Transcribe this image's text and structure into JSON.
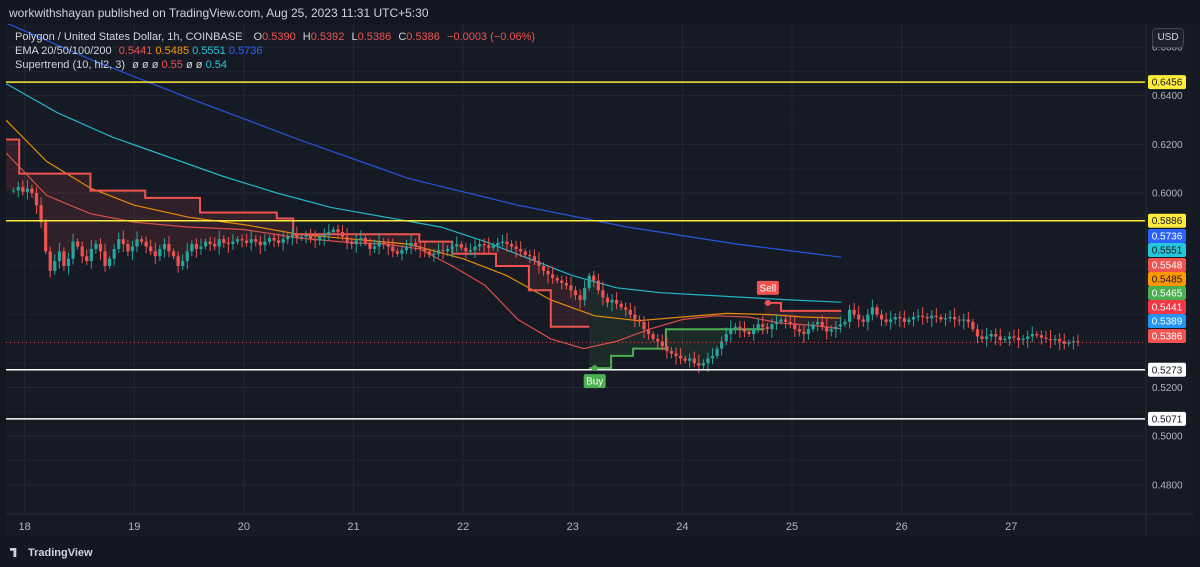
{
  "header": {
    "publisher": "workwithshayan published on TradingView.com, Aug 25, 2023 11:31 UTC+5:30"
  },
  "legend": {
    "symbol": "Polygon / United States Dollar, 1h, COINBASE",
    "ohlc": [
      {
        "k": "O",
        "v": "0.5390"
      },
      {
        "k": "H",
        "v": "0.5392"
      },
      {
        "k": "L",
        "v": "0.5386"
      },
      {
        "k": "C",
        "v": "0.5386"
      }
    ],
    "change": "−0.0003 (−0.06%)",
    "ema_label": "EMA 20/50/100/200",
    "ema_values": [
      {
        "v": "0.5441",
        "color": "#ef5350"
      },
      {
        "v": "0.5485",
        "color": "#ff9800"
      },
      {
        "v": "0.5551",
        "color": "#26c6da"
      },
      {
        "v": "0.5736",
        "color": "#2962ff"
      }
    ],
    "supertrend_label": "Supertrend (10, hl2, 3)",
    "supertrend_symbols": "ø ø ø",
    "supertrend_values": [
      {
        "v": "0.55",
        "color": "#ef5350"
      },
      {
        "v": "ø",
        "color": "#d1d4dc"
      },
      {
        "v": "ø",
        "color": "#d1d4dc"
      },
      {
        "v": "0.54",
        "color": "#26c6da"
      }
    ]
  },
  "currency": "USD",
  "footer": {
    "brand": "TradingView"
  },
  "chart_data": {
    "type": "candlestick",
    "y_axis_ticks": [
      "0.6600",
      "0.6400",
      "0.6200",
      "0.6000",
      "0.5200",
      "0.5000",
      "0.4800"
    ],
    "ylim": [
      0.468,
      0.6695
    ],
    "x_axis_ticks": [
      {
        "label": "18",
        "day": 18
      },
      {
        "label": "19",
        "day": 19
      },
      {
        "label": "20",
        "day": 20
      },
      {
        "label": "21",
        "day": 21
      },
      {
        "label": "22",
        "day": 22
      },
      {
        "label": "23",
        "day": 23
      },
      {
        "label": "24",
        "day": 24
      },
      {
        "label": "25",
        "day": 25
      },
      {
        "label": "26",
        "day": 26
      },
      {
        "label": "27",
        "day": 27
      }
    ],
    "xlim": [
      17.83,
      28.22
    ],
    "horizontal_levels": [
      {
        "value": 0.6456,
        "label": "0.6456",
        "color": "#ffeb3b"
      },
      {
        "value": 0.5886,
        "label": "0.5886",
        "color": "#ffeb3b"
      },
      {
        "value": 0.5273,
        "label": "0.5273",
        "color": "#ffffff"
      },
      {
        "value": 0.5071,
        "label": "0.5071",
        "color": "#ffffff"
      }
    ],
    "price_badges": [
      {
        "value": 0.5736,
        "label": "0.5736",
        "bg": "#2962ff",
        "fg": "#ffffff"
      },
      {
        "value": 0.5551,
        "label": "0.5551",
        "bg": "#26c6da",
        "fg": "#131722"
      },
      {
        "value": 0.5548,
        "label": "0.5548",
        "bg": "#ef5350",
        "fg": "#ffffff"
      },
      {
        "value": 0.5485,
        "label": "0.5485",
        "bg": "#ff9800",
        "fg": "#131722"
      },
      {
        "value": 0.5465,
        "label": "0.5465",
        "bg": "#4caf50",
        "fg": "#ffffff"
      },
      {
        "value": 0.5441,
        "label": "0.5441",
        "bg": "#f23645",
        "fg": "#ffffff"
      },
      {
        "value": 0.5389,
        "label": "0.5389",
        "bg": "#2196f3",
        "fg": "#ffffff"
      },
      {
        "value": 0.5386,
        "label": "0.5386",
        "bg": "#ef5350",
        "fg": "#ffffff"
      }
    ],
    "last_price": 0.5386,
    "ema_lines": [
      {
        "name": "EMA 20",
        "color": "#ef5350",
        "points": [
          [
            17.83,
            0.6165
          ],
          [
            18.2,
            0.599
          ],
          [
            18.6,
            0.5915
          ],
          [
            19.0,
            0.588
          ],
          [
            19.5,
            0.586
          ],
          [
            20.0,
            0.585
          ],
          [
            20.5,
            0.5815
          ],
          [
            21.0,
            0.5795
          ],
          [
            21.3,
            0.579
          ],
          [
            21.6,
            0.577
          ],
          [
            21.9,
            0.57
          ],
          [
            22.2,
            0.562
          ],
          [
            22.5,
            0.548
          ],
          [
            22.8,
            0.54
          ],
          [
            23.1,
            0.536
          ],
          [
            23.4,
            0.539
          ],
          [
            23.7,
            0.544
          ],
          [
            24.0,
            0.548
          ],
          [
            24.3,
            0.5495
          ],
          [
            24.6,
            0.549
          ],
          [
            24.9,
            0.5465
          ],
          [
            25.2,
            0.5455
          ],
          [
            25.45,
            0.5441
          ]
        ]
      },
      {
        "name": "EMA 50",
        "color": "#ff9800",
        "points": [
          [
            17.83,
            0.63
          ],
          [
            18.2,
            0.613
          ],
          [
            18.6,
            0.602
          ],
          [
            19.0,
            0.595
          ],
          [
            19.5,
            0.59
          ],
          [
            20.0,
            0.587
          ],
          [
            20.5,
            0.583
          ],
          [
            21.0,
            0.581
          ],
          [
            21.5,
            0.579
          ],
          [
            22.0,
            0.573
          ],
          [
            22.4,
            0.566
          ],
          [
            22.8,
            0.556
          ],
          [
            23.2,
            0.5495
          ],
          [
            23.6,
            0.5475
          ],
          [
            24.0,
            0.549
          ],
          [
            24.4,
            0.5505
          ],
          [
            24.8,
            0.55
          ],
          [
            25.1,
            0.549
          ],
          [
            25.45,
            0.5485
          ]
        ]
      },
      {
        "name": "EMA 100",
        "color": "#26c6da",
        "points": [
          [
            17.83,
            0.645
          ],
          [
            18.3,
            0.633
          ],
          [
            18.8,
            0.623
          ],
          [
            19.3,
            0.615
          ],
          [
            19.8,
            0.607
          ],
          [
            20.3,
            0.6
          ],
          [
            20.8,
            0.594
          ],
          [
            21.3,
            0.59
          ],
          [
            21.8,
            0.586
          ],
          [
            22.2,
            0.58
          ],
          [
            22.6,
            0.573
          ],
          [
            23.0,
            0.566
          ],
          [
            23.4,
            0.561
          ],
          [
            23.8,
            0.559
          ],
          [
            24.2,
            0.558
          ],
          [
            24.6,
            0.557
          ],
          [
            25.0,
            0.556
          ],
          [
            25.45,
            0.5551
          ]
        ]
      },
      {
        "name": "EMA 200",
        "color": "#2962ff",
        "points": [
          [
            17.83,
            0.67
          ],
          [
            18.6,
            0.655
          ],
          [
            19.5,
            0.639
          ],
          [
            20.5,
            0.622
          ],
          [
            21.5,
            0.606
          ],
          [
            22.5,
            0.595
          ],
          [
            23.5,
            0.586
          ],
          [
            24.5,
            0.579
          ],
          [
            25.45,
            0.5736
          ]
        ]
      }
    ],
    "supertrend": {
      "down_color": "#ef5350",
      "up_color": "#4caf50",
      "down_points": [
        [
          17.83,
          0.622
        ],
        [
          17.95,
          0.622
        ],
        [
          17.95,
          0.608
        ],
        [
          18.6,
          0.608
        ],
        [
          18.6,
          0.601
        ],
        [
          19.1,
          0.601
        ],
        [
          19.1,
          0.598
        ],
        [
          19.6,
          0.598
        ],
        [
          19.6,
          0.592
        ],
        [
          20.3,
          0.592
        ],
        [
          20.3,
          0.5895
        ],
        [
          20.45,
          0.5895
        ],
        [
          20.45,
          0.583
        ],
        [
          21.6,
          0.583
        ],
        [
          21.6,
          0.58
        ],
        [
          21.9,
          0.58
        ],
        [
          21.9,
          0.575
        ],
        [
          22.3,
          0.575
        ],
        [
          22.3,
          0.57
        ],
        [
          22.6,
          0.57
        ],
        [
          22.6,
          0.56
        ],
        [
          22.8,
          0.56
        ],
        [
          22.8,
          0.545
        ],
        [
          23.15,
          0.545
        ]
      ],
      "up_points": [
        [
          23.15,
          0.528
        ],
        [
          23.35,
          0.528
        ],
        [
          23.35,
          0.533
        ],
        [
          23.55,
          0.533
        ],
        [
          23.55,
          0.536
        ],
        [
          23.85,
          0.536
        ],
        [
          23.85,
          0.544
        ],
        [
          24.75,
          0.544
        ]
      ],
      "down2_points": [
        [
          24.75,
          0.5548
        ],
        [
          24.9,
          0.5548
        ],
        [
          24.9,
          0.5515
        ],
        [
          25.45,
          0.5515
        ]
      ],
      "signals": [
        {
          "label": "Buy",
          "day": 23.2,
          "price": 0.528,
          "color": "#4caf50"
        },
        {
          "label": "Sell",
          "day": 24.78,
          "price": 0.5548,
          "color": "#ef5350"
        }
      ]
    },
    "candles_hourly": [
      0.601,
      0.6025,
      0.6005,
      0.6018,
      0.6,
      0.595,
      0.588,
      0.576,
      0.568,
      0.572,
      0.576,
      0.57,
      0.573,
      0.58,
      0.578,
      0.574,
      0.572,
      0.577,
      0.579,
      0.576,
      0.57,
      0.573,
      0.577,
      0.581,
      0.579,
      0.576,
      0.578,
      0.581,
      0.58,
      0.578,
      0.576,
      0.574,
      0.577,
      0.579,
      0.576,
      0.574,
      0.57,
      0.572,
      0.576,
      0.579,
      0.577,
      0.578,
      0.58,
      0.579,
      0.578,
      0.581,
      0.5795,
      0.579,
      0.58,
      0.581,
      0.5805,
      0.5795,
      0.581,
      0.58,
      0.5785,
      0.58,
      0.5815,
      0.5805,
      0.5795,
      0.581,
      0.582,
      0.583,
      0.5815,
      0.582,
      0.5825,
      0.581,
      0.5805,
      0.582,
      0.583,
      0.584,
      0.585,
      0.584,
      0.582,
      0.58,
      0.579,
      0.5805,
      0.5815,
      0.5795,
      0.577,
      0.578,
      0.58,
      0.579,
      0.578,
      0.576,
      0.575,
      0.5765,
      0.578,
      0.5795,
      0.578,
      0.577,
      0.576,
      0.5745,
      0.575,
      0.5765,
      0.576,
      0.577,
      0.578,
      0.579,
      0.5775,
      0.576,
      0.5765,
      0.578,
      0.579,
      0.5785,
      0.5775,
      0.5785,
      0.5795,
      0.58,
      0.579,
      0.578,
      0.577,
      0.576,
      0.5745,
      0.574,
      0.572,
      0.57,
      0.568,
      0.5665,
      0.565,
      0.564,
      0.563,
      0.562,
      0.56,
      0.558,
      0.556,
      0.561,
      0.566,
      0.564,
      0.56,
      0.557,
      0.555,
      0.556,
      0.5545,
      0.553,
      0.552,
      0.55,
      0.548,
      0.547,
      0.544,
      0.542,
      0.54,
      0.539,
      0.537,
      0.535,
      0.534,
      0.533,
      0.532,
      0.531,
      0.532,
      0.53,
      0.529,
      0.53,
      0.532,
      0.533,
      0.536,
      0.539,
      0.542,
      0.544,
      0.545,
      0.544,
      0.543,
      0.542,
      0.544,
      0.546,
      0.545,
      0.544,
      0.546,
      0.547,
      0.548,
      0.547,
      0.546,
      0.544,
      0.543,
      0.542,
      0.544,
      0.546,
      0.547,
      0.545,
      0.543,
      0.544,
      0.545,
      0.546,
      0.547,
      0.552,
      0.55,
      0.548,
      0.547,
      0.55,
      0.553,
      0.55,
      0.548,
      0.547,
      0.548,
      0.549,
      0.5485,
      0.547,
      0.548,
      0.549,
      0.5495,
      0.549,
      0.5485,
      0.5495,
      0.549,
      0.548,
      0.5485,
      0.549,
      0.548,
      0.5475,
      0.548,
      0.547,
      0.544,
      0.541,
      0.54,
      0.541,
      0.542,
      0.541,
      0.5395,
      0.54,
      0.541,
      0.5405,
      0.5395,
      0.54,
      0.541,
      0.542,
      0.5415,
      0.5405,
      0.54,
      0.5395,
      0.54,
      0.539,
      0.538,
      0.5385,
      0.539,
      0.5386
    ]
  }
}
